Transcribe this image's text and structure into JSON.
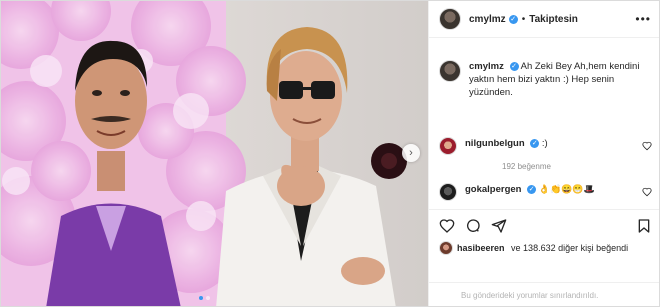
{
  "post": {
    "username": "cmylmz",
    "separator": "•",
    "follow_label": "Takiptesin",
    "more_label": "•••",
    "next_arrow": "›",
    "caption_user": "cmylmz",
    "caption_text": "Ah Zeki Bey Ah,hem kendini yaktın hem bizi yaktın :) Hep senin yüzünden.",
    "carousel": {
      "count": 2,
      "current": 1
    }
  },
  "comments": [
    {
      "user": "nilgunbelgun",
      "text": ":)",
      "likes_label": "192 beğenme"
    },
    {
      "user": "gokalpergen",
      "text": "👌👏😄😁🎩"
    }
  ],
  "liked_by": {
    "user": "hasibeeren",
    "rest": "ve 138.632 diğer kişi beğendi",
    "rest_bold": "138.632 diğer kişi"
  },
  "footer": {
    "text": "Bu gönderideki yorumlar sınırlandırıldı."
  },
  "icons": {
    "verified": "verified-badge-icon",
    "heart": "heart-icon",
    "comment": "comment-icon",
    "share": "share-icon",
    "save": "bookmark-icon",
    "next": "chevron-right-icon"
  },
  "colors": {
    "accent": "#3897f0",
    "border": "#dbdbdb",
    "muted": "#8e8e8e"
  }
}
